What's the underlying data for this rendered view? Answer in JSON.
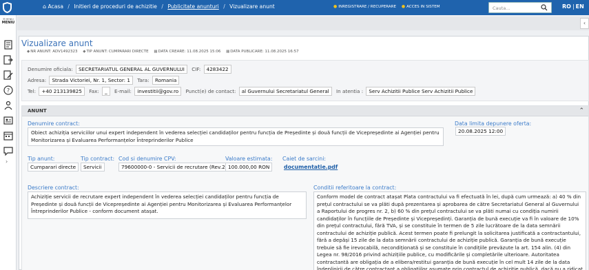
{
  "header": {
    "breadcrumb": {
      "home": "Acasa",
      "item1": "Initieri de proceduri de achizitie",
      "item2": "Publicitate anunturi",
      "item3": "Vizualizare anunt"
    },
    "register_link": "INREGISTRARE / RECUPERARE",
    "login_link": "ACCES IN SISTEM",
    "search_placeholder": "Cauta...",
    "lang_ro": "RO",
    "lang_en": "EN",
    "sep": "/",
    "pipe": "|"
  },
  "sidebar": {
    "menu_small": "☰ MENIU",
    "menu_label": "MENIU"
  },
  "page": {
    "title": "Vizualizare anunt",
    "meta": {
      "nr_anunt": "NR ANUNT: ADV1492323",
      "tip_anunt": "TIP ANUNT: CUMPARARI DIRECTE",
      "data_creare": "DATA CREARE: 11.08.2025 15:06",
      "data_publicare": "DATA PUBLICARE: 11.08.2025 16:57"
    }
  },
  "authority": {
    "denumire_label": "Denumire oficiala:",
    "denumire": "SECRETARIATUL GENERAL AL GUVERNULUI",
    "cif_label": "CIF:",
    "cif": "4283422",
    "adresa_label": "Adresa:",
    "adresa": "Strada Victoriei, Nr. 1, Sector: 1",
    "tara_label": "Tara:",
    "tara": "Romania",
    "tel_label": "Tel:",
    "tel": "+40 213139825",
    "fax_label": "Fax:",
    "fax": "_",
    "email_label": "E-mail:",
    "email": "investitii@gov.ro",
    "contact_label": "Punct(e) de contact:",
    "contact": "al Guvernului Secretariatul General",
    "atentia_label": "In atentia :",
    "atentia": "Serv Achizitii Publice Serv Achizitii Publice"
  },
  "anunt": {
    "section_title": "ANUNT",
    "denumire_contract_label": "Denumire contract:",
    "denumire_contract": "Obiect achiziția serviciilor unui expert independent în vederea selecției candidaților pentru funcția de Președinte și două funcții de Vicepreședinte ai Agenției pentru Monitorizarea și Evaluarea Performanțelor Întreprinderilor Publice",
    "data_limita_label": "Data limita depunere oferta:",
    "data_limita": "20.08.2025 12:00",
    "tip_anunt_label": "Tip anunt:",
    "tip_anunt": "Cumparari directe",
    "tip_contract_label": "Tip contract:",
    "tip_contract": "Servicii",
    "cpv_label": "Cod si denumire CPV:",
    "cpv": "79600000-0 - Servicii de recrutare (Rev.2)",
    "valoare_label": "Valoare estimata:",
    "valoare": "100.000,00  RON",
    "caiet_label": "Caiet de sarcini:",
    "caiet": "documentatie.pdf",
    "descriere_label": "Descriere contract:",
    "descriere": "Achiziție servicii de recrutare expert independent în vederea selecției candidaților pentru funcția de Președinte și două funcții de Vicepreședinte ai Agenției pentru Monitorizarea și Evaluarea Performanțelor Întreprinderilor Publice - conform document atașat.",
    "conditii_label": "Conditii referitoare la contract:",
    "conditii": "Conform model de contract atașat Plata contractului va fi efectuată în lei, după cum urmează: a) 40 % din prețul contractului se va plăti după prezentarea și aprobarea de către Secretariatul General al Guvernului a Raportului de progres nr. 2, b) 60 % din prețul contractului se va plăti numai cu condiția numirii candidaților în funcțiile de Președinte și Vicepreședinți. Garanția de bună execuție va fi în valoare de 10% din prețul contractului, fără TVA, și se constituie în termen de 5 zile lucrătoare de la data semnării contractului de achiziție publică. Acest termen poate fi prelungit la solicitarea justificată a contractantului, fără a depăși 15 zile de la data semnării contractului de achiziție publică. Garanția de bună execuție trebuie să fie irevocabilă, necondiționată și se constituie în condițiile prevăzute la art. 154 alin. (4) din Legea nr. 98/2016 privind achizițiile publice, cu modificările și completările ulterioare. Autoritatea contractantă are obligația de a elibera/restitui garanția de bună execuție în cel mult 14 zile de la data îndeplinirii de către contractant a obligațiilor asumate prin contractul de achiziție publică, dacă nu a ridicat până la acea dată pretenții asupra ei."
  }
}
